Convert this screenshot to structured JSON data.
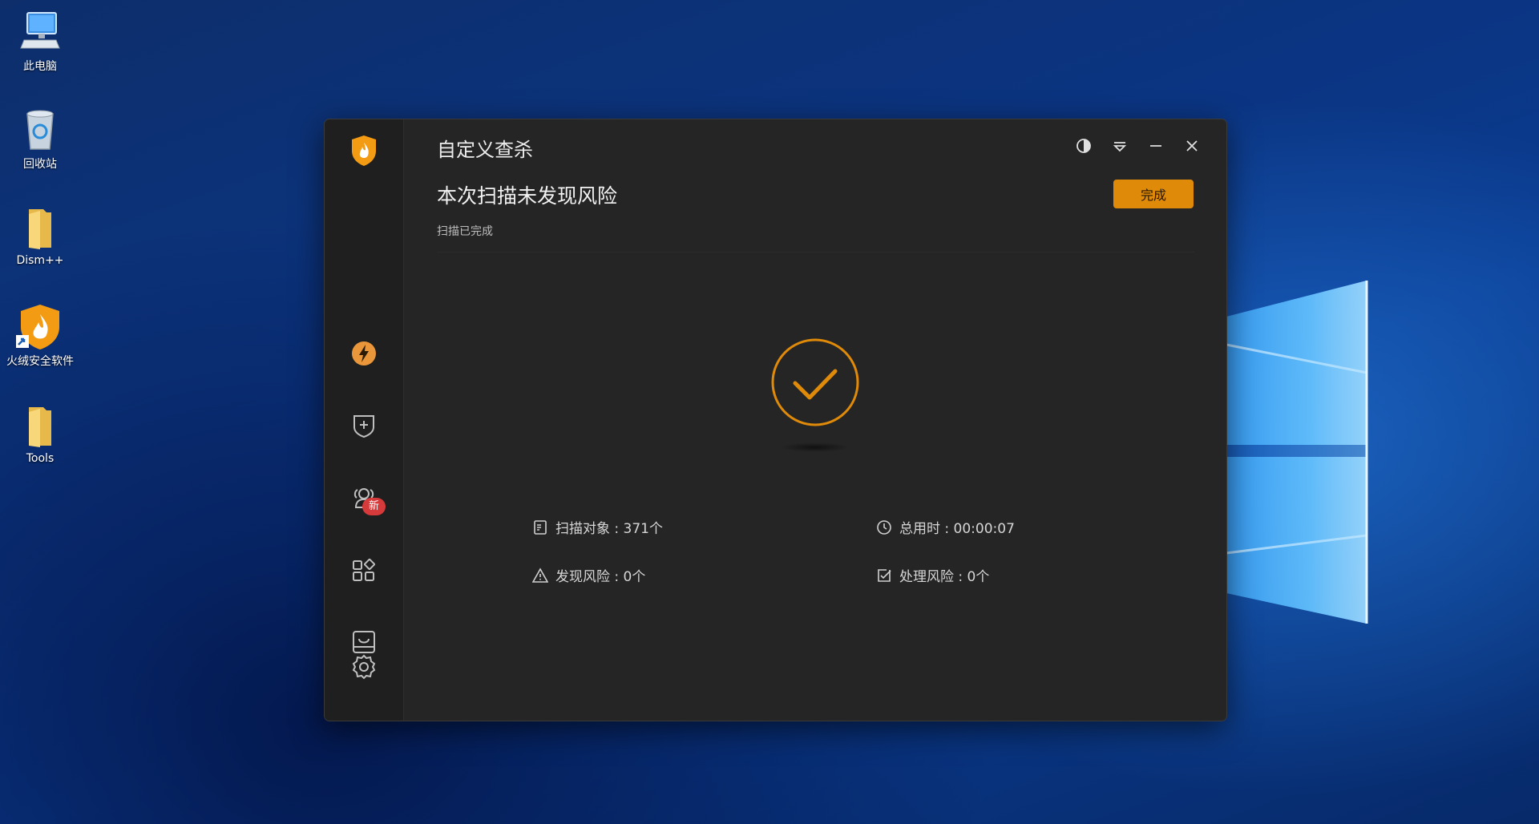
{
  "desktop": {
    "icons": [
      {
        "label": "此电脑",
        "icon": "computer-icon"
      },
      {
        "label": "回收站",
        "icon": "recycle-bin-icon"
      },
      {
        "label": "Dism++",
        "icon": "folder-icon"
      },
      {
        "label": "火绒安全软件",
        "icon": "huorong-shield-icon"
      },
      {
        "label": "Tools",
        "icon": "folder-icon"
      }
    ]
  },
  "app": {
    "title": "自定义查杀",
    "headline": "本次扫描未发现风险",
    "status": "扫描已完成",
    "done_button": "完成",
    "sidebar": {
      "items": [
        {
          "icon": "lightning-icon"
        },
        {
          "icon": "shield-plus-icon"
        },
        {
          "icon": "users-icon"
        },
        {
          "icon": "apps-icon"
        },
        {
          "icon": "box-icon",
          "badge": "新"
        }
      ],
      "settings_icon": "gear-icon"
    },
    "window_buttons": [
      "theme-icon",
      "menu-icon",
      "minimize-icon",
      "close-icon"
    ],
    "stats": {
      "scanned": "扫描对象 : 371个",
      "duration": "总用时 : 00:00:07",
      "risks_found": "发现风险 : 0个",
      "risks_handled": "处理风险 : 0个"
    },
    "colors": {
      "accent": "#e08a0a",
      "background": "#252525",
      "sidebar": "#1f1f1f"
    }
  }
}
